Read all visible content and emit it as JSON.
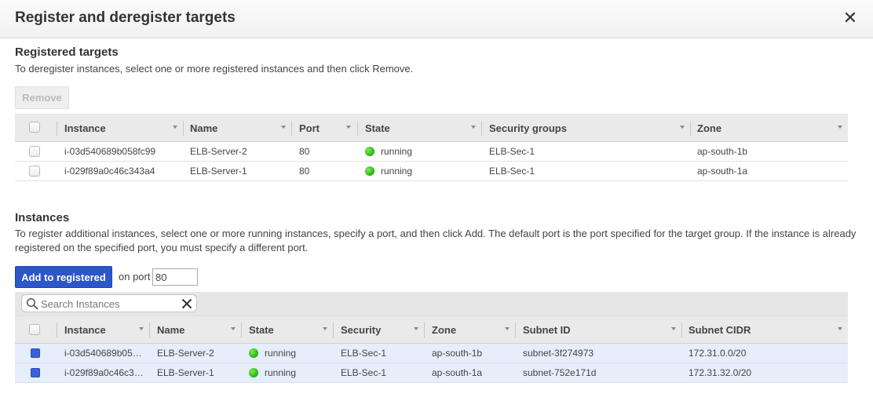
{
  "dialog": {
    "title": "Register and deregister targets",
    "close_symbol": "✕"
  },
  "registered": {
    "title": "Registered targets",
    "description": "To deregister instances, select one or more registered instances and then click Remove.",
    "remove_label": "Remove",
    "columns": [
      "Instance",
      "Name",
      "Port",
      "State",
      "Security groups",
      "Zone"
    ],
    "rows": [
      {
        "instance": "i-03d540689b058fc99",
        "name": "ELB-Server-2",
        "port": "80",
        "state": "running",
        "security": "ELB-Sec-1",
        "zone": "ap-south-1b"
      },
      {
        "instance": "i-029f89a0c46c343a4",
        "name": "ELB-Server-1",
        "port": "80",
        "state": "running",
        "security": "ELB-Sec-1",
        "zone": "ap-south-1a"
      }
    ]
  },
  "instances": {
    "title": "Instances",
    "description_line1": "To register additional instances, select one or more running instances, specify a port, and then click Add. The default port is the port specified for the target group. If the instance is already",
    "description_line2": "registered on the specified port, you must specify a different port.",
    "add_label": "Add to registered",
    "port_label": "on port",
    "port_value": "80",
    "search_placeholder": "Search Instances",
    "columns": [
      "Instance",
      "Name",
      "State",
      "Security",
      "Zone",
      "Subnet ID",
      "Subnet CIDR"
    ],
    "rows": [
      {
        "instance": "i-03d540689b05…",
        "name": "ELB-Server-2",
        "state": "running",
        "security": "ELB-Sec-1",
        "zone": "ap-south-1b",
        "subnet_id": "subnet-3f274973",
        "subnet_cidr": "172.31.0.0/20",
        "checked": true
      },
      {
        "instance": "i-029f89a0c46c3…",
        "name": "ELB-Server-1",
        "state": "running",
        "security": "ELB-Sec-1",
        "zone": "ap-south-1a",
        "subnet_id": "subnet-752e171d",
        "subnet_cidr": "172.31.32.0/20",
        "checked": true
      }
    ]
  },
  "colors": {
    "primary_button": "#2c56c9",
    "running_status": "#22b30f",
    "selected_row": "#e6eefb",
    "header_bg": "#eaeaea"
  }
}
